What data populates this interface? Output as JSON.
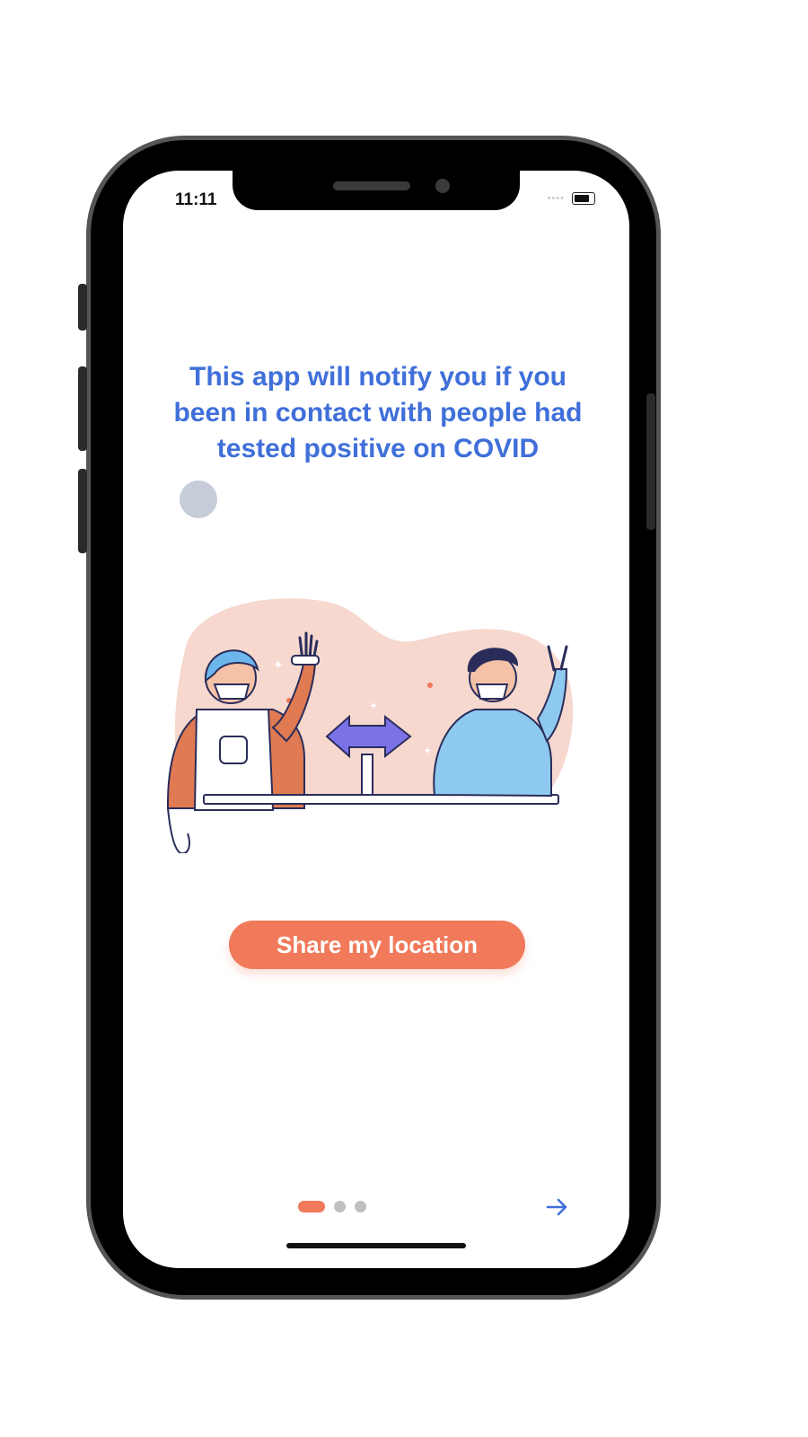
{
  "status_bar": {
    "time": "11:11",
    "signal_text": "••••"
  },
  "onboarding": {
    "headline": "This app will notify you if you been in contact with people had tested positive on COVID",
    "cta_label": "Share my location",
    "page_indicator": {
      "total": 3,
      "active": 1
    },
    "next_icon": "arrow-right-icon"
  },
  "colors": {
    "headline": "#3f6fd9",
    "accent": "#f07a5a",
    "inactive_dot": "#bfbfbf",
    "badge": "#c6cdd8",
    "blob": "#f6d8cf"
  }
}
